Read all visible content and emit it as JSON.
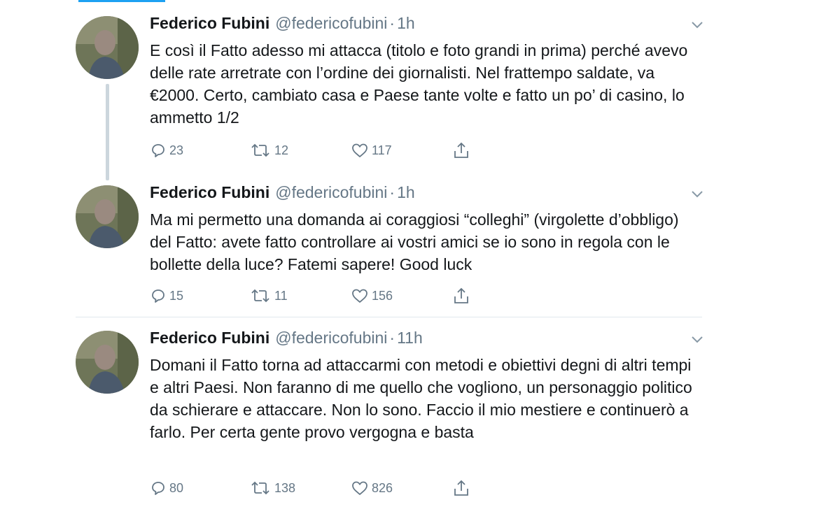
{
  "tweets": [
    {
      "name": "Federico Fubini",
      "handle": "@federicofubini",
      "separator": "·",
      "time": "1h",
      "text": "E così il Fatto adesso mi attacca (titolo e foto grandi in prima) perché avevo delle rate arretrate con l’ordine dei giornalisti. Nel frattempo saldate, va €2000. Certo, cambiato casa e Paese tante volte e fatto un po’ di casino, lo ammetto 1/2",
      "replies": "23",
      "retweets": "12",
      "likes": "117"
    },
    {
      "name": "Federico Fubini",
      "handle": "@federicofubini",
      "separator": "·",
      "time": "1h",
      "text": "Ma mi permetto una domanda ai coraggiosi “colleghi” (virgolette d’obbligo) del Fatto: avete fatto controllare ai vostri amici se io sono in regola con le bollette della luce? Fatemi sapere! Good luck",
      "replies": "15",
      "retweets": "11",
      "likes": "156"
    },
    {
      "name": "Federico Fubini",
      "handle": "@federicofubini",
      "separator": "·",
      "time": "11h",
      "text": "Domani il Fatto torna ad attaccarmi con metodi e obiettivi degni di altri tempi e altri Paesi. Non faranno di me quello che vogliono, un personaggio politico da schierare e attaccare. Non lo sono. Faccio il mio mestiere e continuerò a farlo. Per certa gente provo vergogna e basta",
      "replies": "80",
      "retweets": "138",
      "likes": "826"
    }
  ],
  "icons": {
    "reply": "reply-icon",
    "retweet": "retweet-icon",
    "like": "like-icon",
    "share": "share-icon",
    "caret": "chevron-down-icon"
  },
  "colors": {
    "accent": "#1da1f2",
    "secondary_text": "#657786",
    "thread_line": "#ccd6dd",
    "divider": "#e1e8ed"
  }
}
